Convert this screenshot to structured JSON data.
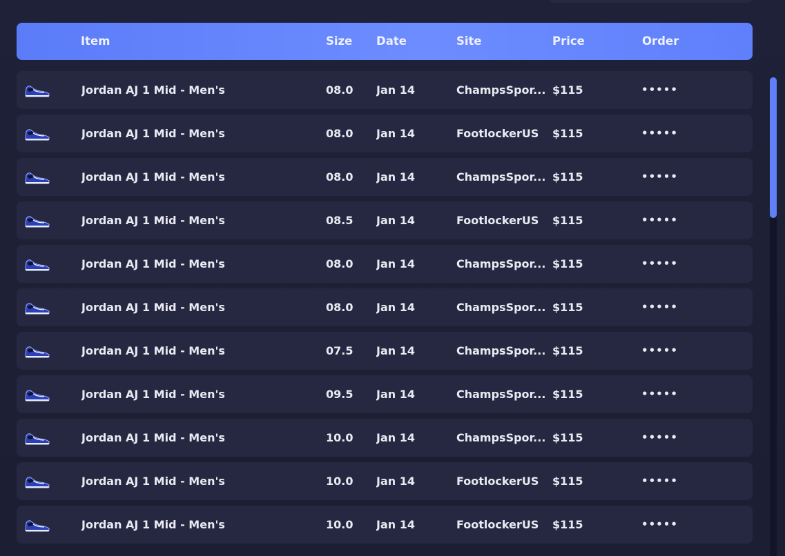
{
  "table": {
    "columns": {
      "item": "Item",
      "size": "Size",
      "date": "Date",
      "site": "Site",
      "price": "Price",
      "order": "Order"
    },
    "rows": [
      {
        "item": "Jordan AJ 1 Mid - Men's",
        "size": "08.0",
        "date": "Jan 14",
        "site": "ChampsSpor...",
        "price": "$115",
        "order": "•••••"
      },
      {
        "item": "Jordan AJ 1 Mid - Men's",
        "size": "08.0",
        "date": "Jan 14",
        "site": "FootlockerUS",
        "price": "$115",
        "order": "•••••"
      },
      {
        "item": "Jordan AJ 1 Mid - Men's",
        "size": "08.0",
        "date": "Jan 14",
        "site": "ChampsSpor...",
        "price": "$115",
        "order": "•••••"
      },
      {
        "item": "Jordan AJ 1 Mid - Men's",
        "size": "08.5",
        "date": "Jan 14",
        "site": "FootlockerUS",
        "price": "$115",
        "order": "•••••"
      },
      {
        "item": "Jordan AJ 1 Mid - Men's",
        "size": "08.0",
        "date": "Jan 14",
        "site": "ChampsSpor...",
        "price": "$115",
        "order": "•••••"
      },
      {
        "item": "Jordan AJ 1 Mid - Men's",
        "size": "08.0",
        "date": "Jan 14",
        "site": "ChampsSpor...",
        "price": "$115",
        "order": "•••••"
      },
      {
        "item": "Jordan AJ 1 Mid - Men's",
        "size": "07.5",
        "date": "Jan 14",
        "site": "ChampsSpor...",
        "price": "$115",
        "order": "•••••"
      },
      {
        "item": "Jordan AJ 1 Mid - Men's",
        "size": "09.5",
        "date": "Jan 14",
        "site": "ChampsSpor...",
        "price": "$115",
        "order": "•••••"
      },
      {
        "item": "Jordan AJ 1 Mid - Men's",
        "size": "10.0",
        "date": "Jan 14",
        "site": "ChampsSpor...",
        "price": "$115",
        "order": "•••••"
      },
      {
        "item": "Jordan AJ 1 Mid - Men's",
        "size": "10.0",
        "date": "Jan 14",
        "site": "FootlockerUS",
        "price": "$115",
        "order": "•••••"
      },
      {
        "item": "Jordan AJ 1 Mid - Men's",
        "size": "10.0",
        "date": "Jan 14",
        "site": "FootlockerUS",
        "price": "$115",
        "order": "•••••"
      }
    ]
  },
  "colors": {
    "accent": "#6080f7",
    "row_bg": "#262842",
    "page_bg": "#1c1e33"
  },
  "icons": {
    "row_thumbnail": "sneaker-icon"
  }
}
